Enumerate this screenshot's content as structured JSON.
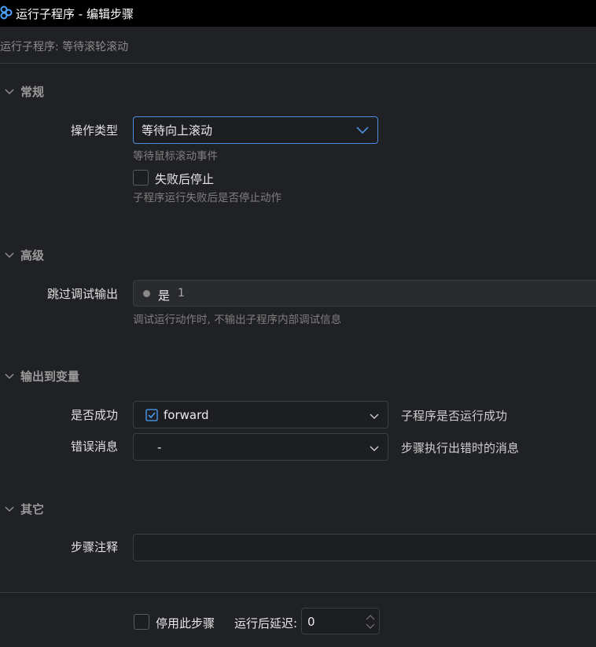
{
  "window": {
    "title": "运行子程序 - 编辑步骤"
  },
  "subtitle": "运行子程序: 等待滚轮滚动",
  "sections": {
    "general": {
      "title": "常规",
      "operation_type": {
        "label": "操作类型",
        "value": "等待向上滚动",
        "hint": "等待鼠标滚动事件"
      },
      "stop_on_fail": {
        "label": "失败后停止",
        "hint": "子程序运行失败后是否停止动作",
        "checked": false
      }
    },
    "advanced": {
      "title": "高级",
      "skip_debug": {
        "label": "跳过调试输出",
        "value_text": "是",
        "value_num": "1",
        "hint": "调试运行动作时, 不输出子程序内部调试信息"
      }
    },
    "output": {
      "title": "输出到变量",
      "success": {
        "label": "是否成功",
        "value": "forward",
        "hint": "子程序是否运行成功"
      },
      "error_msg": {
        "label": "错误消息",
        "value": "-",
        "hint": "步骤执行出错时的消息"
      }
    },
    "other": {
      "title": "其它",
      "comment": {
        "label": "步骤注释",
        "value": ""
      }
    }
  },
  "footer": {
    "disable_step": {
      "label": "停用此步骤",
      "checked": false
    },
    "delay": {
      "label": "运行后延迟:",
      "value": "0"
    }
  },
  "colors": {
    "accent": "#4a8fe0",
    "background": "#202124",
    "titlebar": "#000000"
  }
}
